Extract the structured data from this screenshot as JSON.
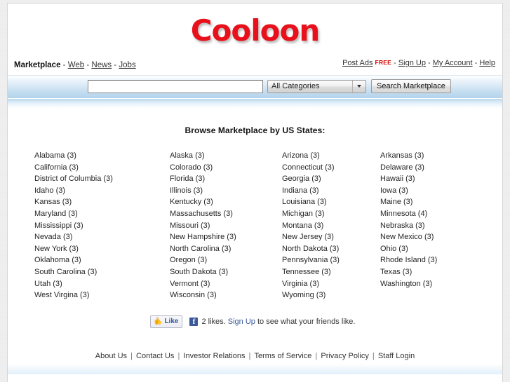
{
  "site": {
    "logo_text": "Cooloon",
    "logo_color": "#e8111b"
  },
  "nav": {
    "primary_label": "Marketplace",
    "dash": "-",
    "links": [
      {
        "label": "Web"
      },
      {
        "label": "News"
      },
      {
        "label": "Jobs"
      }
    ],
    "account_links": [
      {
        "label": "Post Ads",
        "badge": "FREE"
      },
      {
        "label": "Sign Up"
      },
      {
        "label": "My Account"
      },
      {
        "label": "Help"
      }
    ]
  },
  "search": {
    "value": "",
    "placeholder": "",
    "category_selected": "All Categories",
    "category_options": [
      "All Categories"
    ],
    "button_label": "Search Marketplace"
  },
  "main": {
    "heading": "Browse Marketplace by US States:",
    "states": [
      {
        "name": "Alabama",
        "count": "(3)"
      },
      {
        "name": "Alaska",
        "count": "(3)"
      },
      {
        "name": "Arizona",
        "count": "(3)"
      },
      {
        "name": "Arkansas",
        "count": "(3)"
      },
      {
        "name": "California",
        "count": "(3)"
      },
      {
        "name": "Colorado",
        "count": "(3)"
      },
      {
        "name": "Connecticut",
        "count": "(3)"
      },
      {
        "name": "Delaware",
        "count": "(3)"
      },
      {
        "name": "District of Columbia",
        "count": "(3)"
      },
      {
        "name": "Florida",
        "count": "(3)"
      },
      {
        "name": "Georgia",
        "count": "(3)"
      },
      {
        "name": "Hawaii",
        "count": "(3)"
      },
      {
        "name": "Idaho",
        "count": "(3)"
      },
      {
        "name": "Illinois",
        "count": "(3)"
      },
      {
        "name": "Indiana",
        "count": "(3)"
      },
      {
        "name": "Iowa",
        "count": "(3)"
      },
      {
        "name": "Kansas",
        "count": "(3)"
      },
      {
        "name": "Kentucky",
        "count": "(3)"
      },
      {
        "name": "Louisiana",
        "count": "(3)"
      },
      {
        "name": "Maine",
        "count": "(3)"
      },
      {
        "name": "Maryland",
        "count": "(3)"
      },
      {
        "name": "Massachusetts",
        "count": "(3)"
      },
      {
        "name": "Michigan",
        "count": "(3)"
      },
      {
        "name": "Minnesota",
        "count": "(4)"
      },
      {
        "name": "Mississippi",
        "count": "(3)"
      },
      {
        "name": "Missouri",
        "count": "(3)"
      },
      {
        "name": "Montana",
        "count": "(3)"
      },
      {
        "name": "Nebraska",
        "count": "(3)"
      },
      {
        "name": "Nevada",
        "count": "(3)"
      },
      {
        "name": "New Hampshire",
        "count": "(3)"
      },
      {
        "name": "New Jersey",
        "count": "(3)"
      },
      {
        "name": "New Mexico",
        "count": "(3)"
      },
      {
        "name": "New York",
        "count": "(3)"
      },
      {
        "name": "North Carolina",
        "count": "(3)"
      },
      {
        "name": "North Dakota",
        "count": "(3)"
      },
      {
        "name": "Ohio",
        "count": "(3)"
      },
      {
        "name": "Oklahoma",
        "count": "(3)"
      },
      {
        "name": "Oregon",
        "count": "(3)"
      },
      {
        "name": "Pennsylvania",
        "count": "(3)"
      },
      {
        "name": "Rhode Island",
        "count": "(3)"
      },
      {
        "name": "South Carolina",
        "count": "(3)"
      },
      {
        "name": "South Dakota",
        "count": "(3)"
      },
      {
        "name": "Tennessee",
        "count": "(3)"
      },
      {
        "name": "Texas",
        "count": "(3)"
      },
      {
        "name": "Utah",
        "count": "(3)"
      },
      {
        "name": "Vermont",
        "count": "(3)"
      },
      {
        "name": "Virginia",
        "count": "(3)"
      },
      {
        "name": "Washington",
        "count": "(3)"
      },
      {
        "name": "West Virgina",
        "count": "(3)"
      },
      {
        "name": "Wisconsin",
        "count": "(3)"
      },
      {
        "name": "Wyoming",
        "count": "(3)"
      }
    ]
  },
  "social": {
    "like_button_label": "Like",
    "like_icon": "thumbs-up-icon",
    "facebook_icon": "facebook-f-icon",
    "likes_text": "2 likes.",
    "signup_link": "Sign Up",
    "trailing_text": "to see what your friends like."
  },
  "footer": {
    "links": [
      {
        "label": "About Us"
      },
      {
        "label": "Contact Us"
      },
      {
        "label": "Investor Relations"
      },
      {
        "label": "Terms of Service"
      },
      {
        "label": "Privacy Policy"
      },
      {
        "label": "Staff Login"
      }
    ],
    "separator": "|"
  }
}
